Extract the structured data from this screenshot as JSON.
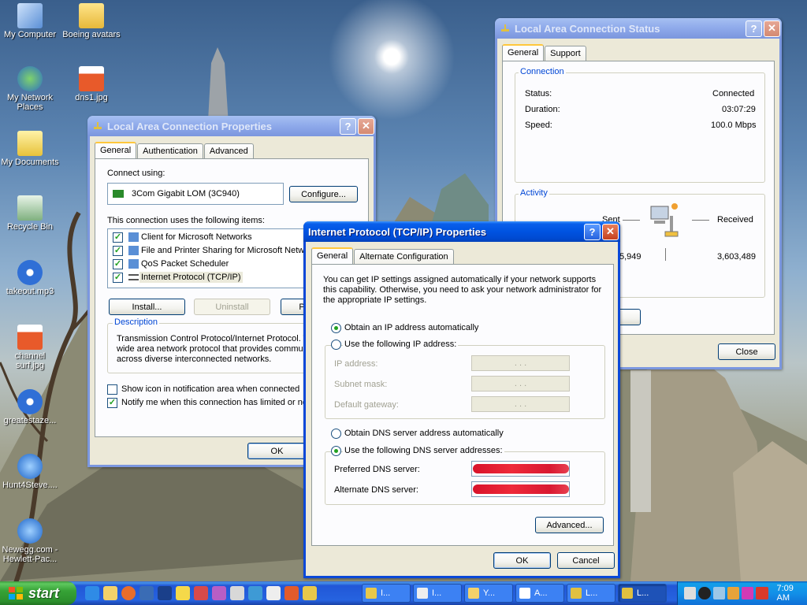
{
  "desktop": {
    "icons": [
      {
        "label": "My Computer"
      },
      {
        "label": "Boeing avatars"
      },
      {
        "label": "My Network Places"
      },
      {
        "label": "dns1.jpg"
      },
      {
        "label": "My Documents"
      },
      {
        "label": "Recycle Bin"
      },
      {
        "label": "takeout.mp3"
      },
      {
        "label": "channel surf.jpg"
      },
      {
        "label": "greatestaze..."
      },
      {
        "label": "Hunt4Steve...."
      },
      {
        "label": "Newegg.com - Hewlett-Pac..."
      }
    ]
  },
  "lac_props": {
    "title": "Local Area Connection Properties",
    "tabs": [
      "General",
      "Authentication",
      "Advanced"
    ],
    "connect_using_label": "Connect using:",
    "adapter": "3Com Gigabit LOM (3C940)",
    "configure": "Configure...",
    "items_label": "This connection uses the following items:",
    "items": [
      {
        "label": "Client for Microsoft Networks",
        "checked": true
      },
      {
        "label": "File and Printer Sharing for Microsoft Networks",
        "checked": true
      },
      {
        "label": "QoS Packet Scheduler",
        "checked": true
      },
      {
        "label": "Internet Protocol (TCP/IP)",
        "checked": true
      }
    ],
    "install": "Install...",
    "uninstall": "Uninstall",
    "properties": "Properties",
    "description_label": "Description",
    "description_lines": [
      "Transmission Control Protocol/Internet Protocol. The default",
      "wide area network protocol that provides communication",
      "across diverse interconnected networks."
    ],
    "show_icon": "Show icon in notification area when connected",
    "notify": "Notify me when this connection has limited or no connectivity",
    "ok": "OK"
  },
  "status": {
    "title": "Local Area Connection Status",
    "tabs": [
      "General",
      "Support"
    ],
    "connection_label": "Connection",
    "status_label": "Status:",
    "status_value": "Connected",
    "duration_label": "Duration:",
    "duration_value": "03:07:29",
    "speed_label": "Speed:",
    "speed_value": "100.0 Mbps",
    "activity_label": "Activity",
    "sent_label": "Sent",
    "received_label": "Received",
    "sent_partial": "5,949",
    "received_value": "3,603,489",
    "close": "Close"
  },
  "tcpip": {
    "title": "Internet Protocol (TCP/IP) Properties",
    "tabs": [
      "General",
      "Alternate Configuration"
    ],
    "intro_lines": [
      "You can get IP settings assigned automatically if your network supports",
      "this capability. Otherwise, you need to ask your network administrator for",
      "the appropriate IP settings."
    ],
    "obtain_ip": "Obtain an IP address automatically",
    "use_ip": "Use the following IP address:",
    "ip_address": "IP address:",
    "subnet": "Subnet mask:",
    "gateway": "Default gateway:",
    "obtain_dns": "Obtain DNS server address automatically",
    "use_dns": "Use the following DNS server addresses:",
    "preferred_dns": "Preferred DNS server:",
    "alternate_dns": "Alternate DNS server:",
    "advanced": "Advanced...",
    "ok": "OK",
    "cancel": "Cancel",
    "ip_dots": ". . ."
  },
  "taskbar": {
    "start": "start",
    "items": [
      "I...",
      "I...",
      "Y...",
      "A...",
      "L...",
      "L..."
    ],
    "time": "7:09 AM"
  }
}
